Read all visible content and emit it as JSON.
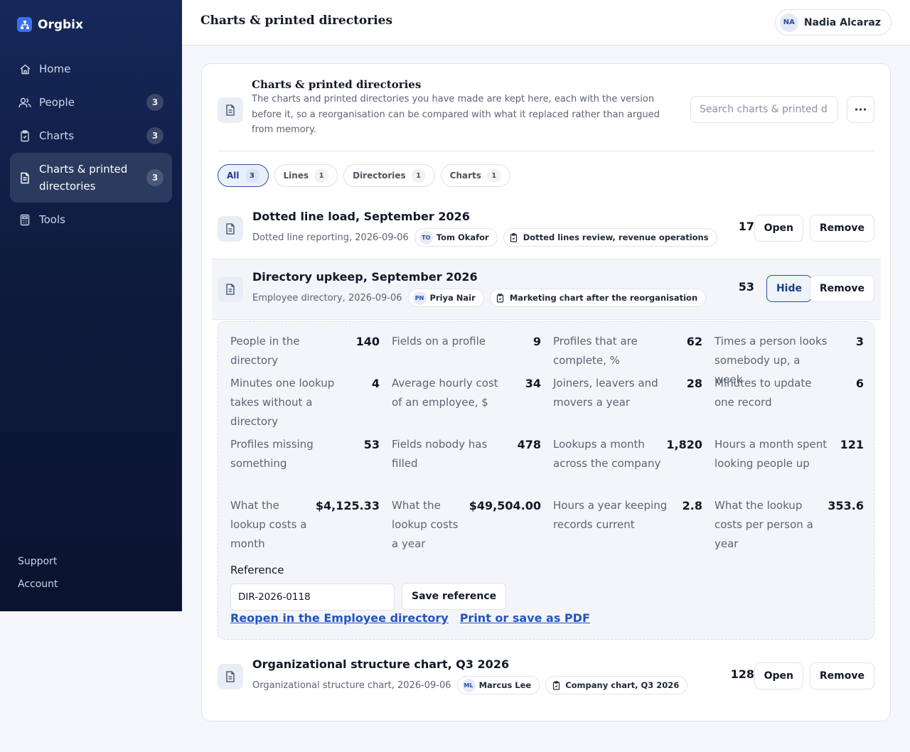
{
  "app": {
    "name": "Orgbix"
  },
  "sidebar": {
    "items": [
      {
        "label": "Home",
        "icon": "home-icon"
      },
      {
        "label": "People",
        "icon": "people-icon",
        "badge": "3"
      },
      {
        "label": "Charts",
        "icon": "clipboard-icon",
        "badge": "3"
      },
      {
        "label": "Charts & printed directories",
        "icon": "document-icon",
        "badge": "3",
        "active": true
      },
      {
        "label": "Tools",
        "icon": "calculator-icon"
      }
    ],
    "footer": {
      "support": "Support",
      "account": "Account"
    }
  },
  "topbar": {
    "title": "Charts & printed directories",
    "user": {
      "initials": "NA",
      "name": "Nadia Alcaraz"
    }
  },
  "header": {
    "title": "Charts & printed directories",
    "description": "The charts and printed directories you have made are kept here, each with the version before it, so a reorganisation can be compared with what it replaced rather than argued from memory.",
    "search_placeholder": "Search charts & printed d",
    "more_label": "⋯"
  },
  "filters": [
    {
      "label": "All",
      "count": "3",
      "active": true
    },
    {
      "label": "Lines",
      "count": "1"
    },
    {
      "label": "Directories",
      "count": "1"
    },
    {
      "label": "Charts",
      "count": "1"
    }
  ],
  "items": [
    {
      "title": "Dotted line load, September 2026",
      "meta": "Dotted line reporting, 2026-09-06",
      "person": {
        "initials": "TO",
        "name": "Tom Okafor"
      },
      "source": "Dotted lines review, revenue operations",
      "count": "17",
      "open_label": "Open",
      "remove_label": "Remove"
    },
    {
      "title": "Directory upkeep, September 2026",
      "meta": "Employee directory, 2026-09-06",
      "person": {
        "initials": "PN",
        "name": "Priya Nair"
      },
      "source": "Marketing chart after the reorganisation",
      "count": "53",
      "open_label": "Hide",
      "remove_label": "Remove"
    },
    {
      "title": "Organizational structure chart, Q3 2026",
      "meta": "Organizational structure chart, 2026-09-06",
      "person": {
        "initials": "ML",
        "name": "Marcus Lee"
      },
      "source": "Company chart, Q3 2026",
      "count": "128",
      "open_label": "Open",
      "remove_label": "Remove"
    }
  ],
  "details": {
    "stats": [
      {
        "label": "People in the directory",
        "value": "140"
      },
      {
        "label": "Fields on a profile",
        "value": "9"
      },
      {
        "label": "Profiles that are complete, %",
        "value": "62"
      },
      {
        "label": "Times a person looks somebody up, a week",
        "value": "3"
      },
      {
        "label": "Minutes one lookup takes without a directory",
        "value": "4"
      },
      {
        "label": "Average hourly cost of an employee, $",
        "value": "34"
      },
      {
        "label": "Joiners, leavers and movers a year",
        "value": "28"
      },
      {
        "label": "Minutes to update one record",
        "value": "6"
      },
      {
        "label": "Profiles missing something",
        "value": "53"
      },
      {
        "label": "Fields nobody has filled",
        "value": "478"
      },
      {
        "label": "Lookups a month across the company",
        "value": "1,820"
      },
      {
        "label": "Hours a month spent looking people up",
        "value": "121"
      },
      {
        "label": "What the lookup costs a month",
        "value": "$4,125.33"
      },
      {
        "label": "What the lookup costs a year",
        "value": "$49,504.00"
      },
      {
        "label": "Hours a year keeping records current",
        "value": "2.8"
      },
      {
        "label": "What the lookup costs per person a year",
        "value": "353.6"
      }
    ],
    "reference_label": "Reference",
    "reference_value": "DIR-2026-0118",
    "save_reference_label": "Save reference",
    "reopen_link": "Reopen in the Employee directory",
    "print_link": "Print or save as PDF"
  },
  "colors": {
    "accent": "#2f4f9e",
    "link": "#2353c4",
    "sidebar": "#0d1a3b"
  }
}
